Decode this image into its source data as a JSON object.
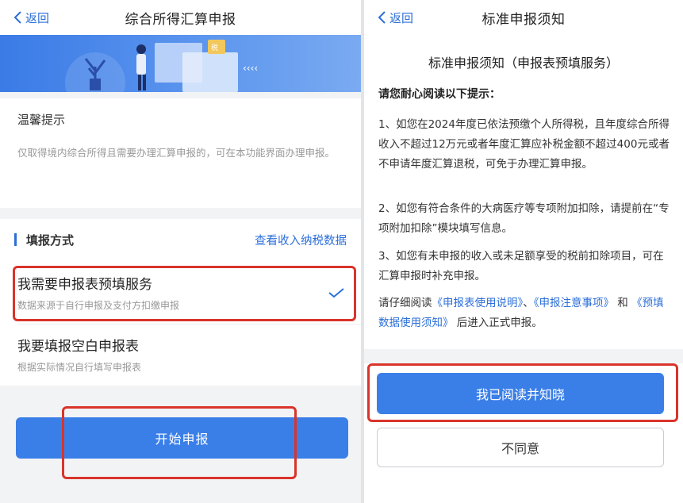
{
  "left": {
    "back_label": "返回",
    "title": "综合所得汇算申报",
    "notice": {
      "title": "温馨提示",
      "body": "仅取得境内综合所得且需要办理汇算申报的，可在本功能界面办理申报。"
    },
    "fill_method": {
      "label": "填报方式",
      "link": "查看收入纳税数据",
      "options": [
        {
          "title": "我需要申报表预填服务",
          "subtitle": "数据来源于自行申报及支付方扣缴申报",
          "selected": true
        },
        {
          "title": "我要填报空白申报表",
          "subtitle": "根据实际情况自行填写申报表",
          "selected": false
        }
      ]
    },
    "start_button": "开始申报"
  },
  "right": {
    "back_label": "返回",
    "title": "标准申报须知",
    "doc_title": "标准申报须知（申报表预填服务）",
    "lead": "请您耐心阅读以下提示：",
    "paragraphs": [
      "1、如您在2024年度已依法预缴个人所得税，且年度综合所得收入不超过12万元或者年度汇算应补税金额不超过400元或者不申请年度汇算退税，可免于办理汇算申报。",
      "2、如您有符合条件的大病医疗等专项附加扣除，请提前在“专项附加扣除”模块填写信息。",
      "3、如您有未申报的收入或未足额享受的税前扣除项目，可在汇算申报时补充申报。"
    ],
    "closing": {
      "prefix": "请仔细阅读",
      "link1": "《申报表使用说明》",
      "sep": "、",
      "link2": "《申报注意事项》",
      "and": "和",
      "link3": "《预填数据使用须知》",
      "suffix": "后进入正式申报。"
    },
    "agree_button": "我已阅读并知晓",
    "disagree_button": "不同意"
  },
  "colors": {
    "accent": "#2c6fd8",
    "button": "#3a7fe8",
    "highlight": "#d9342b"
  },
  "icons": {
    "back": "chevron-left-icon",
    "check": "check-icon"
  }
}
